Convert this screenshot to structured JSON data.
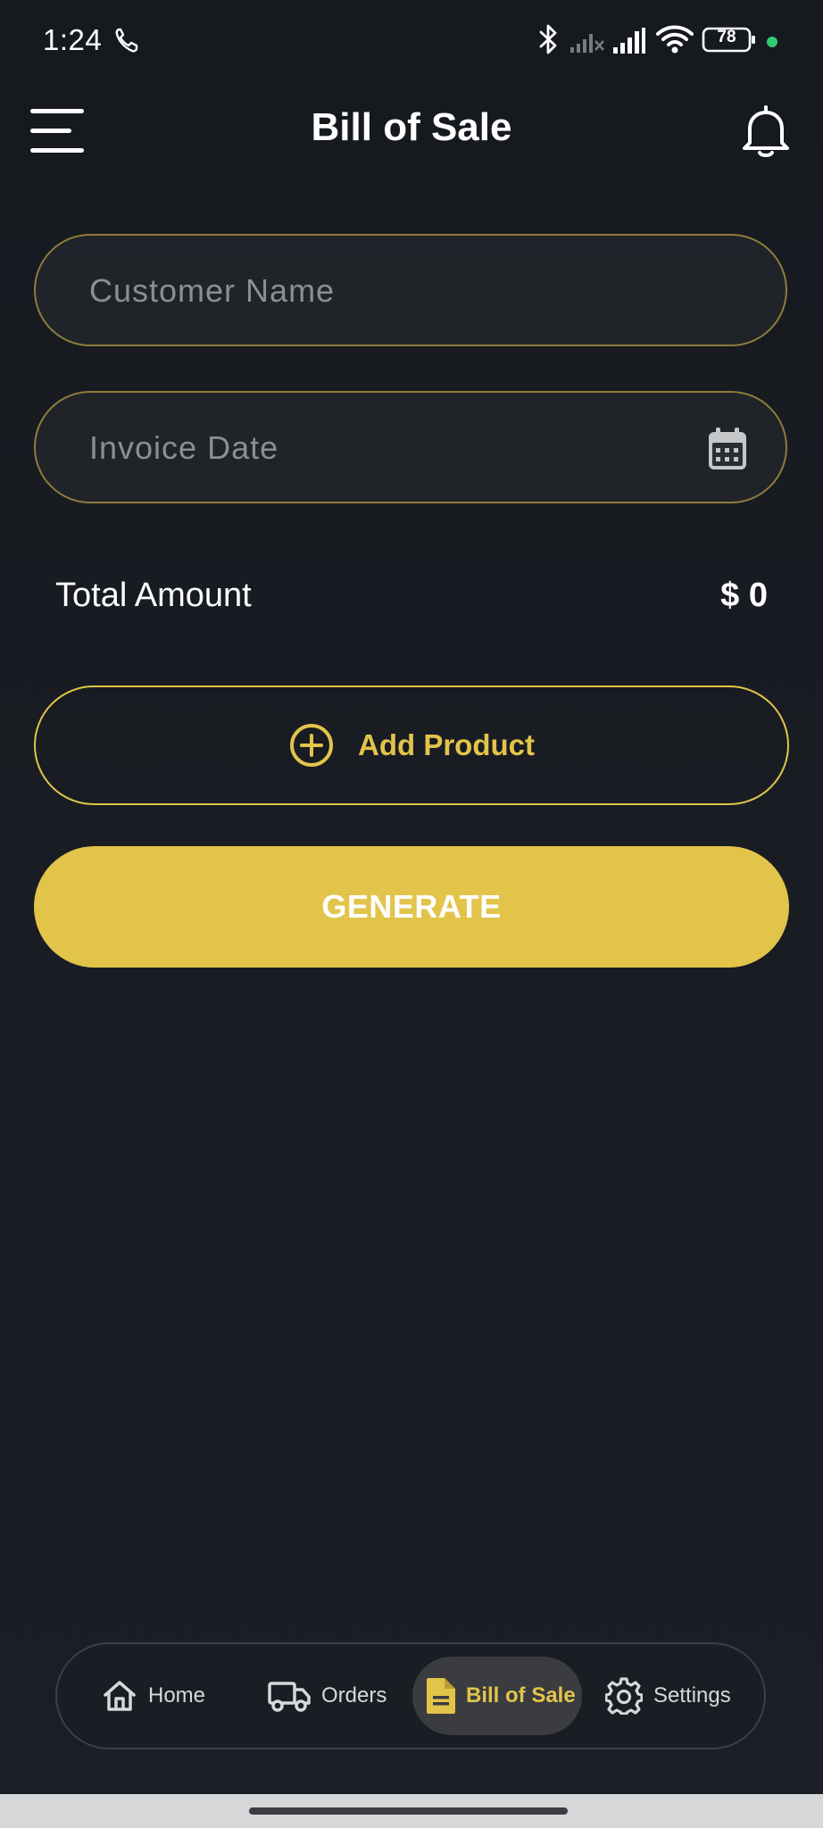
{
  "status_bar": {
    "time": "1:24",
    "battery": "78"
  },
  "header": {
    "title": "Bill of Sale"
  },
  "form": {
    "customer_name": {
      "value": "",
      "placeholder": "Customer Name"
    },
    "invoice_date": {
      "value": "",
      "placeholder": "Invoice Date"
    }
  },
  "total": {
    "label": "Total Amount",
    "value": "$ 0"
  },
  "actions": {
    "add_product_label": "Add Product",
    "generate_label": "GENERATE"
  },
  "bottom_nav": {
    "items": [
      {
        "label": "Home",
        "icon": "home-icon",
        "active": false
      },
      {
        "label": "Orders",
        "icon": "truck-icon",
        "active": false
      },
      {
        "label": "Bill of Sale",
        "icon": "document-icon",
        "active": true
      },
      {
        "label": "Settings",
        "icon": "gear-icon",
        "active": false
      }
    ]
  },
  "colors": {
    "accent": "#e2c44a",
    "background": "#171b21",
    "field_border": "#8d7c3c",
    "nav_active_bg": "#3a3c40",
    "battery_dot": "#2ecc71"
  }
}
